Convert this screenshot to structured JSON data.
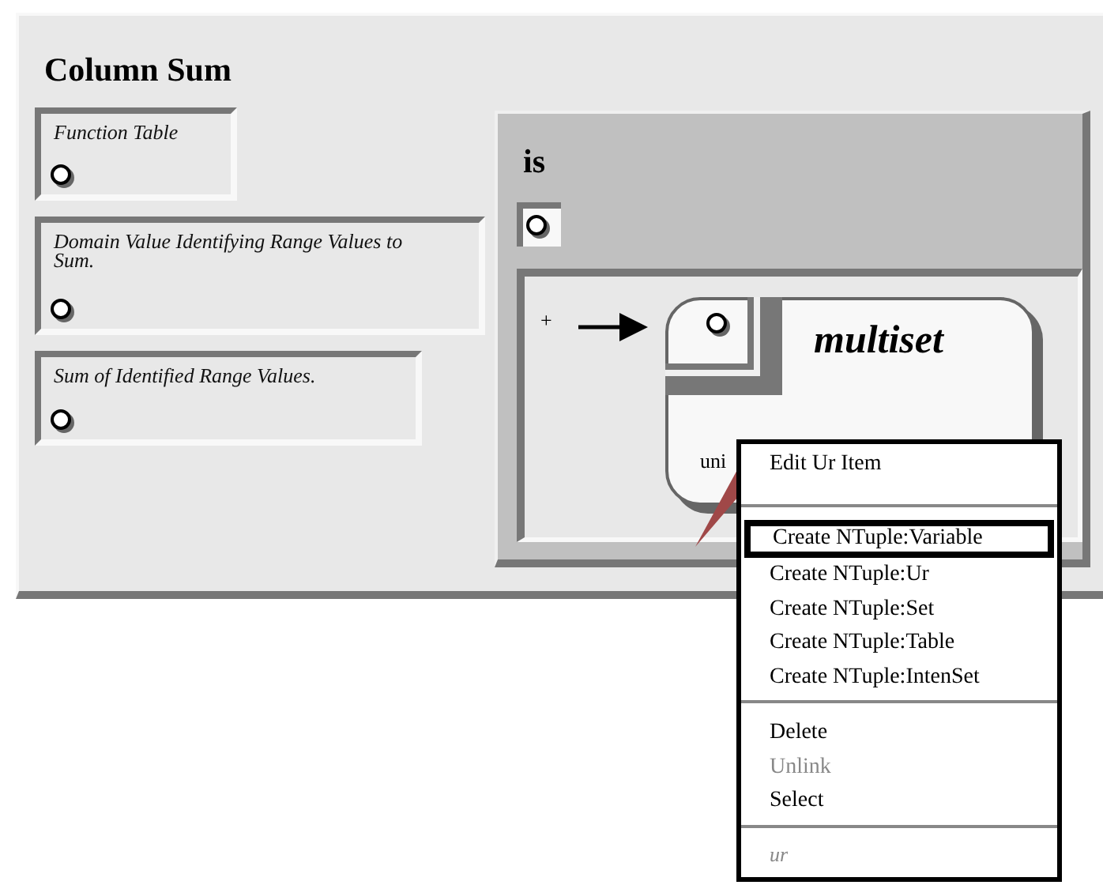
{
  "title": "Column Sum",
  "inputs": [
    {
      "label": "Function Table"
    },
    {
      "label": "Domain Value Identifying Range Values to Sum."
    },
    {
      "label": "Sum of Identified Range Values."
    }
  ],
  "is_panel": {
    "title": "is",
    "plus": "+",
    "node": {
      "title": "multiset",
      "caption": "uni"
    }
  },
  "context_menu": {
    "items": [
      {
        "kind": "item",
        "label": "Edit Ur Item",
        "selected": false,
        "disabled": false
      },
      {
        "kind": "separator"
      },
      {
        "kind": "item",
        "label": "Create NTuple:Variable",
        "selected": true,
        "disabled": false
      },
      {
        "kind": "item",
        "label": "Create NTuple:Ur",
        "selected": false,
        "disabled": false
      },
      {
        "kind": "item",
        "label": "Create NTuple:Set",
        "selected": false,
        "disabled": false
      },
      {
        "kind": "item",
        "label": "Create NTuple:Table",
        "selected": false,
        "disabled": false
      },
      {
        "kind": "item",
        "label": "Create NTuple:IntenSet",
        "selected": false,
        "disabled": false
      },
      {
        "kind": "separator"
      },
      {
        "kind": "item",
        "label": "Delete",
        "selected": false,
        "disabled": false
      },
      {
        "kind": "item",
        "label": "Unlink",
        "selected": false,
        "disabled": true
      },
      {
        "kind": "item",
        "label": "Select",
        "selected": false,
        "disabled": false
      },
      {
        "kind": "separator"
      },
      {
        "kind": "caption",
        "label": "ur"
      }
    ]
  }
}
